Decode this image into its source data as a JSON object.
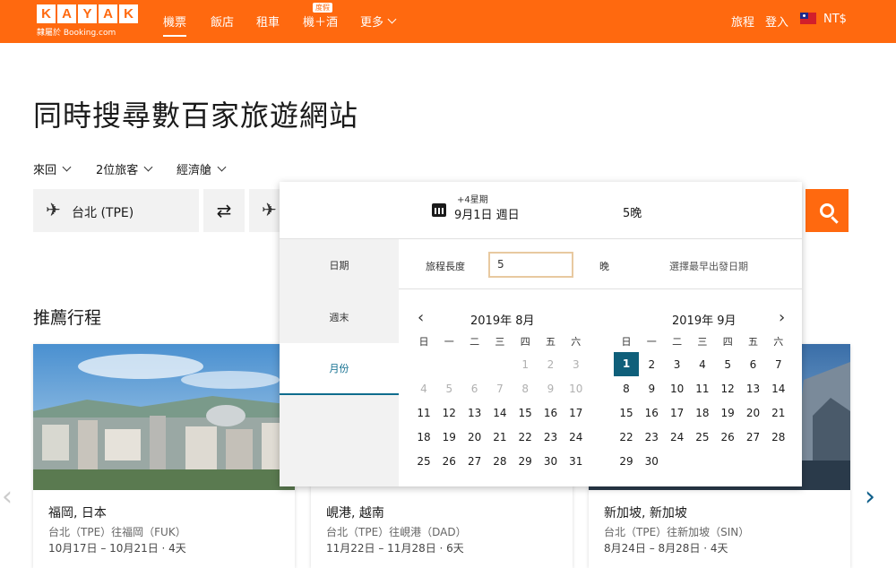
{
  "header": {
    "logo_letters": [
      "K",
      "A",
      "Y",
      "A",
      "K"
    ],
    "logo_sub": "隸屬於 Booking.com",
    "nav": [
      {
        "label": "機票",
        "active": true
      },
      {
        "label": "飯店"
      },
      {
        "label": "租車"
      },
      {
        "label": "機＋酒",
        "badge": "度假"
      },
      {
        "label": "更多"
      }
    ],
    "trips": "旅程",
    "login": "登入",
    "currency": "NT$"
  },
  "page_title": "同時搜尋數百家旅遊網站",
  "options": {
    "trip_type": "來回",
    "travelers": "2位旅客",
    "cabin": "經濟艙"
  },
  "search": {
    "origin": "台北 (TPE)"
  },
  "popup": {
    "duration_note": "+4星期",
    "start_date": "9月1日 週日",
    "nights": "5晚",
    "tabs": [
      "日期",
      "週末",
      "月份"
    ],
    "active_tab": 2,
    "length_label": "旅程長度",
    "length_value": "5",
    "length_unit": "晚",
    "pick_earliest": "選擇最早出發日期",
    "weekdays": [
      "日",
      "一",
      "二",
      "三",
      "四",
      "五",
      "六"
    ],
    "months": [
      {
        "title": "2019年 8月",
        "first_weekday": 4,
        "days": 31,
        "gray_until": 10
      },
      {
        "title": "2019年 9月",
        "first_weekday": 0,
        "days": 30,
        "selected": 1
      }
    ]
  },
  "recommend_title": "推薦行程",
  "cards": [
    {
      "title": "福岡, 日本",
      "route": "台北（TPE）往福岡（FUK）",
      "dates": "10月17日 – 10月21日 · 4天"
    },
    {
      "title": "峴港, 越南",
      "route": "台北（TPE）往峴港（DAD）",
      "dates": "11月22日 – 11月28日 · 6天"
    },
    {
      "title": "新加坡, 新加坡",
      "route": "台北（TPE）往新加坡（SIN）",
      "dates": "8月24日 – 8月28日 · 4天"
    }
  ],
  "colors": {
    "brand": "#ff690f",
    "accent": "#0f5f7a"
  }
}
